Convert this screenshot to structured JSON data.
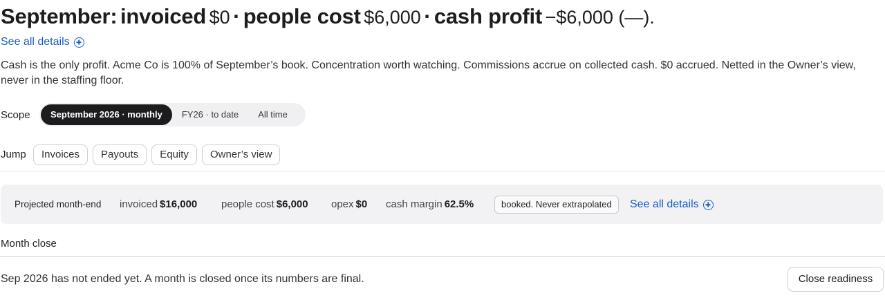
{
  "headline": {
    "month_label": "September:",
    "invoiced_label": "invoiced",
    "invoiced_value": "$0",
    "sep1": "·",
    "people_cost_label": "people cost",
    "people_cost_value": "$6,000",
    "sep2": "·",
    "cash_profit_label": "cash profit",
    "cash_profit_value": "−$6,000 (—)."
  },
  "see_all_details": "See all details",
  "summary": "Cash is the only profit. Acme Co is 100% of September’s book. Concentration worth watching. Commissions accrue on collected cash. $0 accrued. Netted in the Owner’s view, never in the staffing floor.",
  "scope": {
    "label": "Scope",
    "options": [
      "September 2026 · monthly",
      "FY26 · to date",
      "All time"
    ],
    "selected": "September 2026 · monthly"
  },
  "jump": {
    "label": "Jump",
    "items": [
      "Invoices",
      "Payouts",
      "Equity",
      "Owner’s view"
    ]
  },
  "projection": {
    "title": "Projected month-end",
    "invoiced_label": "invoiced",
    "invoiced_value": "$16,000",
    "people_cost_label": "people cost",
    "people_cost_value": "$6,000",
    "opex_label": "opex",
    "opex_value": "$0",
    "cash_margin_label": "cash margin",
    "cash_margin_value": "62.5%",
    "badge": "booked. Never extrapolated",
    "details_link": "See all details"
  },
  "month_close": {
    "title": "Month close",
    "message": "Sep 2026 has not ended yet. A month is closed once its numbers are final.",
    "button": "Close readiness"
  },
  "colors": {
    "link": "#1a5fc4",
    "active_segment": "#1c1c1e",
    "panel_bg": "#f2f2f4"
  }
}
